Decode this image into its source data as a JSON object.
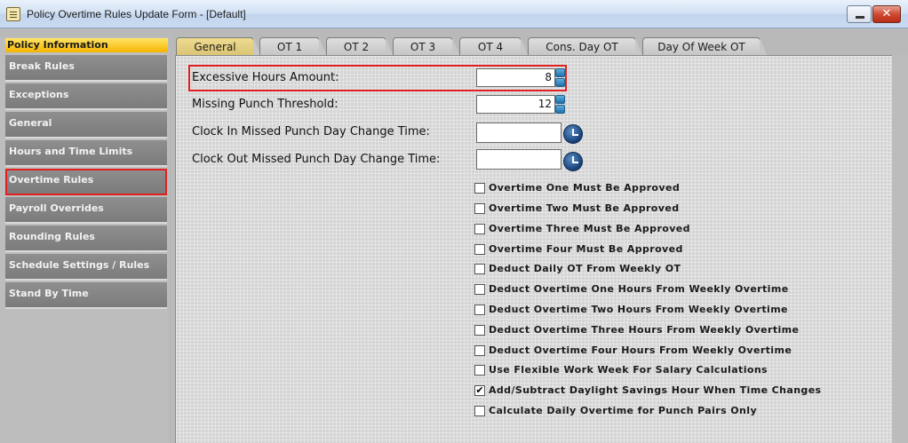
{
  "window": {
    "title": "Policy Overtime Rules Update Form - [Default]",
    "close_glyph": "✕"
  },
  "sidebar": {
    "header": "Policy Information",
    "items": [
      {
        "label": "Break Rules"
      },
      {
        "label": "Exceptions"
      },
      {
        "label": "General"
      },
      {
        "label": "Hours and Time Limits"
      },
      {
        "label": "Overtime Rules",
        "selected": true
      },
      {
        "label": "Payroll Overrides"
      },
      {
        "label": "Rounding Rules"
      },
      {
        "label": "Schedule Settings / Rules"
      },
      {
        "label": "Stand By Time"
      }
    ]
  },
  "tabs": [
    {
      "label": "General",
      "active": true
    },
    {
      "label": "OT 1"
    },
    {
      "label": "OT 2"
    },
    {
      "label": "OT 3"
    },
    {
      "label": "OT 4"
    },
    {
      "label": "Cons. Day OT"
    },
    {
      "label": "Day Of Week OT"
    }
  ],
  "form": {
    "excessive_hours": {
      "label": "Excessive Hours Amount:",
      "value": "8"
    },
    "missing_punch": {
      "label": "Missing Punch Threshold:",
      "value": "12"
    },
    "clock_in_change": {
      "label": "Clock In Missed Punch Day Change Time:",
      "value": ""
    },
    "clock_out_change": {
      "label": "Clock Out Missed Punch Day Change Time:",
      "value": ""
    }
  },
  "checkboxes": [
    {
      "label": "Overtime One Must Be Approved",
      "checked": false
    },
    {
      "label": "Overtime Two Must Be Approved",
      "checked": false
    },
    {
      "label": "Overtime Three Must Be Approved",
      "checked": false
    },
    {
      "label": "Overtime Four Must Be Approved",
      "checked": false
    },
    {
      "label": "Deduct Daily OT From Weekly OT",
      "checked": false
    },
    {
      "label": "Deduct Overtime One Hours From Weekly Overtime",
      "checked": false
    },
    {
      "label": "Deduct Overtime Two Hours From Weekly Overtime",
      "checked": false
    },
    {
      "label": "Deduct Overtime Three Hours From Weekly Overtime",
      "checked": false
    },
    {
      "label": "Deduct Overtime Four Hours From Weekly Overtime",
      "checked": false
    },
    {
      "label": "Use Flexible Work Week For Salary Calculations",
      "checked": false
    },
    {
      "label": "Add/Subtract Daylight Savings Hour When Time Changes",
      "checked": true,
      "mark": "✔"
    },
    {
      "label": "Calculate Daily Overtime for Punch Pairs Only",
      "checked": false
    }
  ],
  "colors": {
    "highlight": "#e02020",
    "nav_header": "#f5b400",
    "spinner": "#1d6fa8"
  }
}
